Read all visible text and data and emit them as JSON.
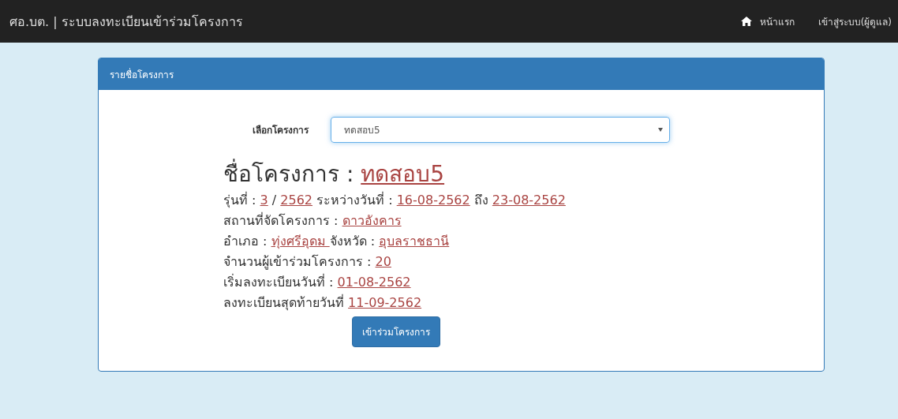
{
  "navbar": {
    "brand": "ศอ.บต. | ระบบลงทะเบียนเข้าร่วมโครงการ",
    "links": [
      {
        "label": "หน้าแรก",
        "kind": "home"
      },
      {
        "label": "เข้าสู่ระบบ(ผู้ดูแล)",
        "kind": "plain"
      }
    ]
  },
  "panel": {
    "heading": "รายชื่อโครงการ",
    "select": {
      "label": "เลือกโครงการ",
      "value": "ทดสอบ5"
    },
    "title": [
      {
        "text": "ชื่อโครงการ : ",
        "kind": "text"
      },
      {
        "text": "ทดสอบ5",
        "kind": "link"
      }
    ],
    "details": [
      [
        {
          "text": "รุ่นที่ : ",
          "kind": "text"
        },
        {
          "text": "3",
          "kind": "link"
        },
        {
          "text": " / ",
          "kind": "text"
        },
        {
          "text": "2562",
          "kind": "link"
        },
        {
          "text": " ระหว่างวันที่ : ",
          "kind": "text"
        },
        {
          "text": "16-08-2562",
          "kind": "link"
        },
        {
          "text": " ถึง ",
          "kind": "text"
        },
        {
          "text": "23-08-2562",
          "kind": "link"
        }
      ],
      [
        {
          "text": "สถานที่จัดโครงการ : ",
          "kind": "text"
        },
        {
          "text": "ดาวอังคาร",
          "kind": "link"
        }
      ],
      [
        {
          "text": "อำเภอ : ",
          "kind": "text"
        },
        {
          "text": "ทุ่งศรีอุดม ",
          "kind": "link"
        },
        {
          "text": "จังหวัด : ",
          "kind": "text"
        },
        {
          "text": "อุบลราชธานี",
          "kind": "link"
        }
      ],
      [
        {
          "text": "จำนวนผู้เข้าร่วมโครงการ : ",
          "kind": "text"
        },
        {
          "text": "20",
          "kind": "link"
        }
      ],
      [
        {
          "text": "เริ่มลงทะเบียนวันที่ : ",
          "kind": "text"
        },
        {
          "text": "01-08-2562",
          "kind": "link"
        }
      ],
      [
        {
          "text": "ลงทะเบียนสุดท้ายวันที่ ",
          "kind": "text"
        },
        {
          "text": "11-09-2562",
          "kind": "link"
        }
      ]
    ],
    "button": "เข้าร่วมโครงการ"
  }
}
